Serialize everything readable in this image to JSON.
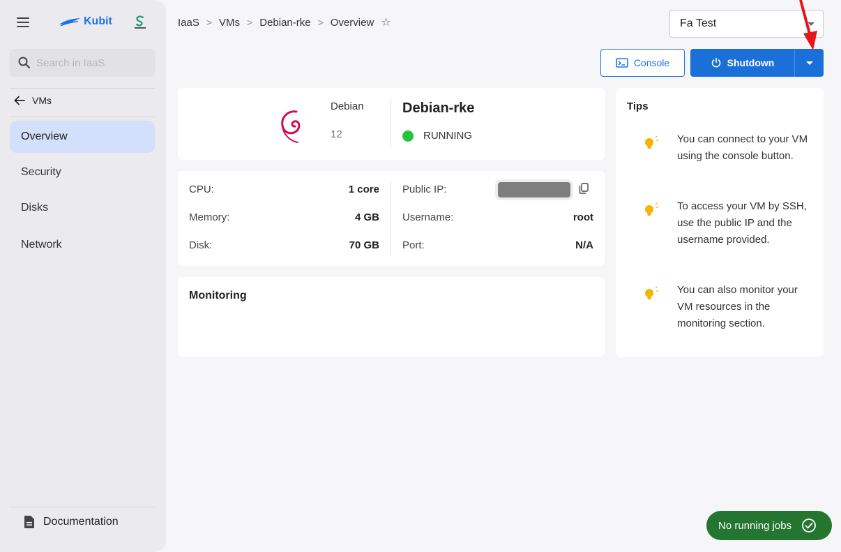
{
  "sidebar": {
    "brand": "Kubit",
    "search_placeholder": "Search in IaaS",
    "back_label": "VMs",
    "items": [
      {
        "label": "Overview",
        "active": true
      },
      {
        "label": "Security"
      },
      {
        "label": "Disks"
      },
      {
        "label": "Network"
      }
    ],
    "documentation": "Documentation"
  },
  "header": {
    "breadcrumb": [
      "IaaS",
      "VMs",
      "Debian-rke",
      "Overview"
    ],
    "org_select": "Fa Test",
    "console_label": "Console",
    "shutdown_label": "Shutdown"
  },
  "vm": {
    "os_name": "Debian",
    "os_version": "12",
    "name": "Debian-rke",
    "status": "RUNNING",
    "status_color": "#27c43a"
  },
  "specs": {
    "cpu_label": "CPU:",
    "cpu_value": "1 core",
    "memory_label": "Memory:",
    "memory_value": "4 GB",
    "disk_label": "Disk:",
    "disk_value": "70 GB",
    "public_ip_label": "Public IP:",
    "username_label": "Username:",
    "username_value": "root",
    "port_label": "Port:",
    "port_value": "N/A"
  },
  "monitoring": {
    "title": "Monitoring"
  },
  "tips": {
    "title": "Tips",
    "items": [
      "You can connect to your VM using the console button.",
      "To access your VM by SSH, use the public IP and the username provided.",
      "You can also monitor your VM resources in the monitoring section."
    ]
  },
  "jobs": {
    "label": "No running jobs"
  },
  "colors": {
    "accent": "#1a6fd9",
    "jobs_bg": "#23752f",
    "annotation_arrow": "#e8141b"
  }
}
